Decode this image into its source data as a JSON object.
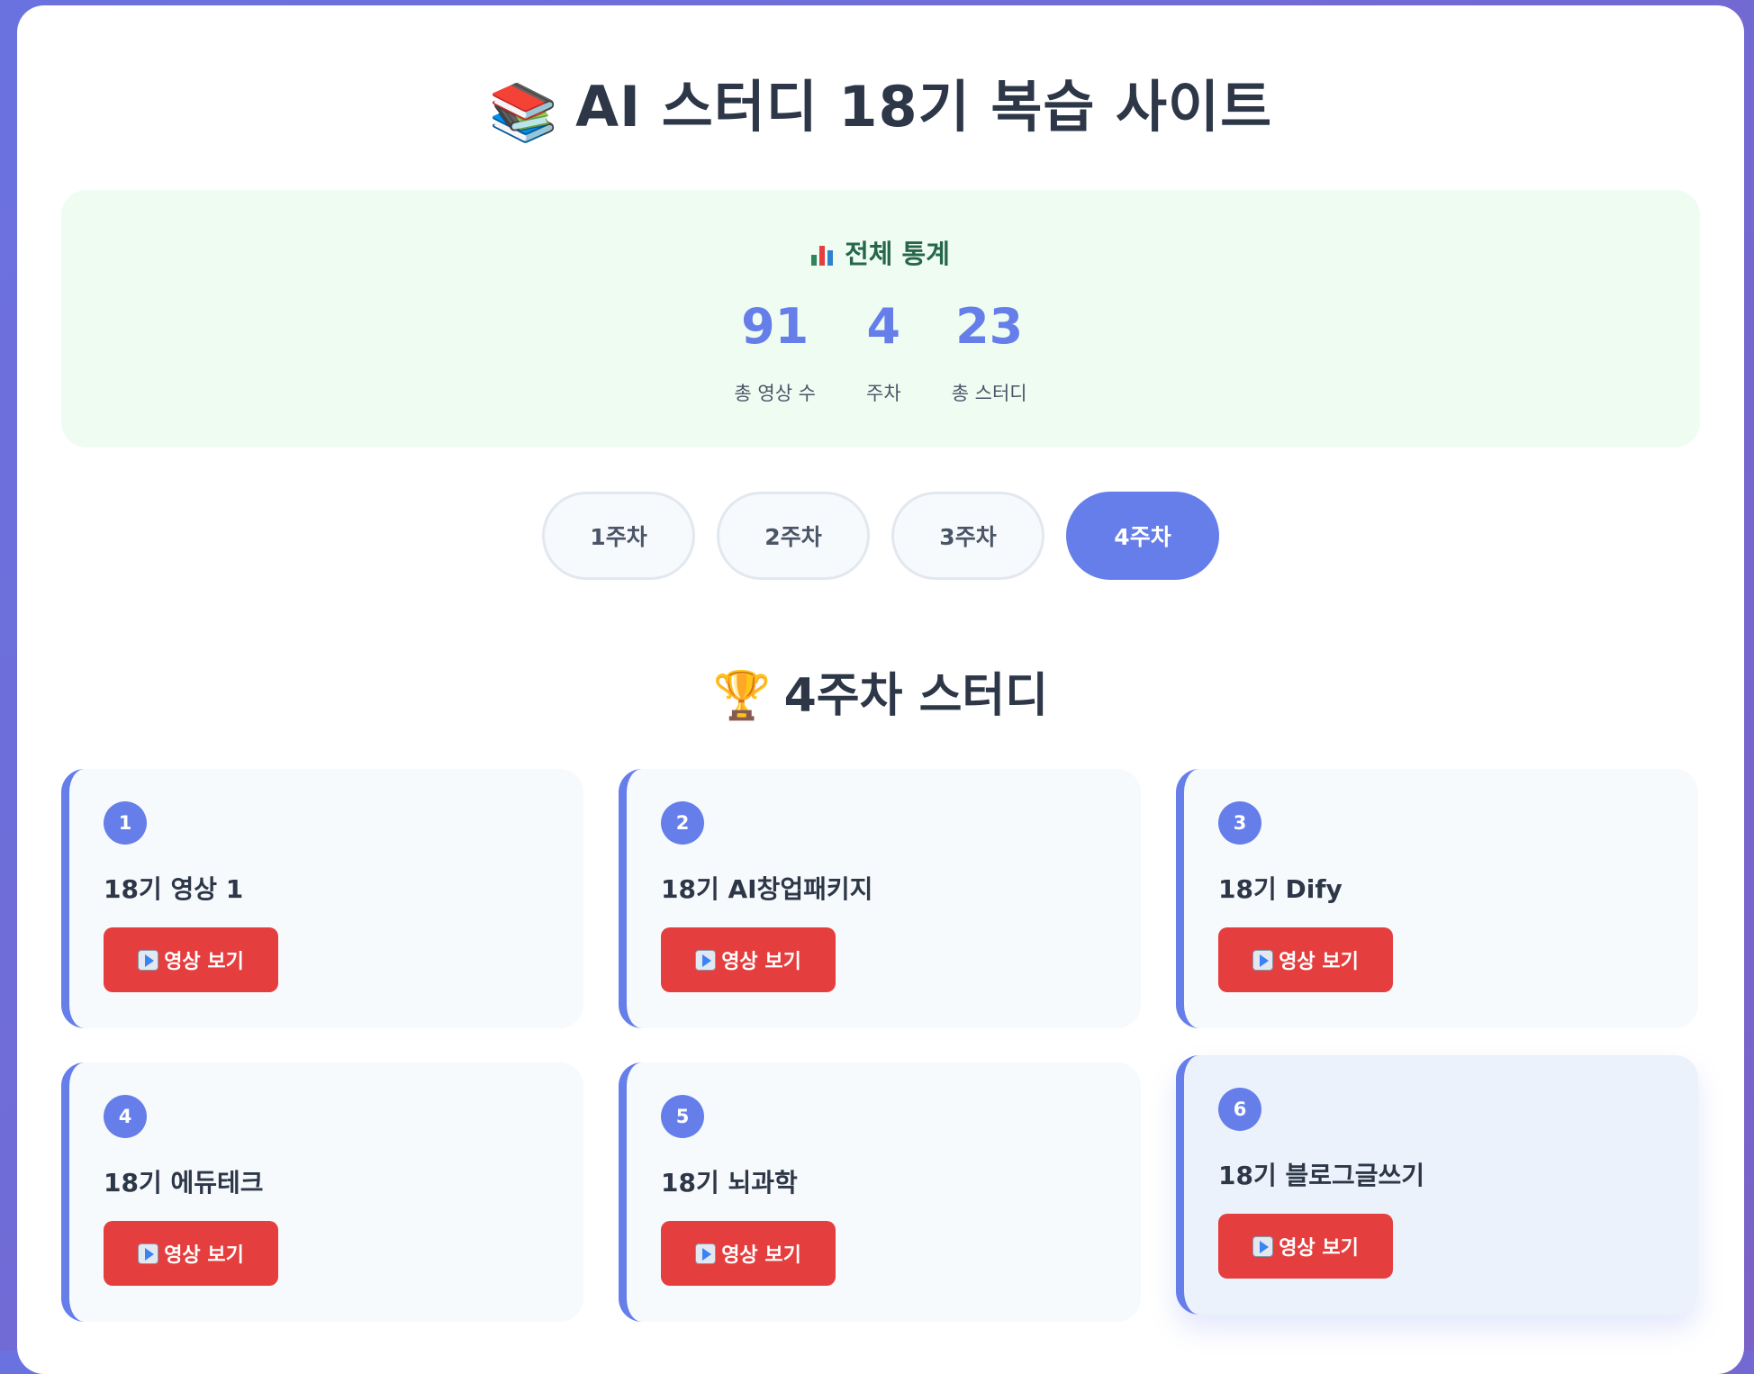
{
  "header": {
    "emoji": "📚",
    "title": "AI 스터디 18기 복습 사이트"
  },
  "stats": {
    "title": "전체 통계",
    "icon": "bar-chart-icon",
    "items": [
      {
        "value": "91",
        "label": "총 영상 수"
      },
      {
        "value": "4",
        "label": "주차"
      },
      {
        "value": "23",
        "label": "총 스터디"
      }
    ]
  },
  "week_tabs": [
    {
      "label": "1주차",
      "active": false
    },
    {
      "label": "2주차",
      "active": false
    },
    {
      "label": "3주차",
      "active": false
    },
    {
      "label": "4주차",
      "active": true
    }
  ],
  "section": {
    "emoji": "🏆",
    "title": "4주차 스터디"
  },
  "cards": [
    {
      "number": "1",
      "title": "18기 영상 1",
      "button": "영상 보기"
    },
    {
      "number": "2",
      "title": "18기 AI창업패키지",
      "button": "영상 보기"
    },
    {
      "number": "3",
      "title": "18기 Dify",
      "button": "영상 보기"
    },
    {
      "number": "4",
      "title": "18기 에듀테크",
      "button": "영상 보기"
    },
    {
      "number": "5",
      "title": "18기 뇌과학",
      "button": "영상 보기"
    },
    {
      "number": "6",
      "title": "18기 블로그글쓰기",
      "button": "영상 보기"
    }
  ],
  "colors": {
    "accent": "#667eea",
    "button": "#e53e3e",
    "stats_bg": "#effcf1",
    "card_bg": "#f7fafc"
  }
}
